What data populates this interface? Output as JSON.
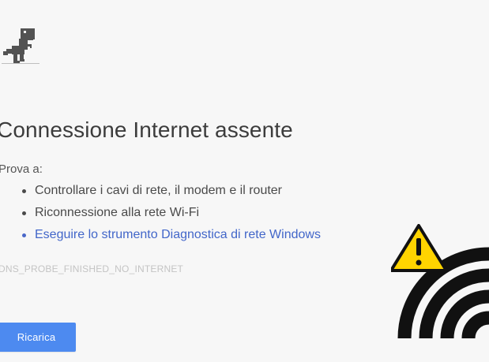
{
  "page": {
    "title": "Connessione Internet assente",
    "suggestions_intro": "Prova a:",
    "suggestions": [
      {
        "label": "Controllare i cavi di rete, il modem e il router"
      },
      {
        "label": "Riconnessione alla rete Wi-Fi"
      },
      {
        "label": "Eseguire lo strumento Diagnostica di rete Windows"
      }
    ],
    "error_code": "DNS_PROBE_FINISHED_NO_INTERNET",
    "reload_label": "Ricarica"
  },
  "icons": {
    "dino": "t-rex-icon",
    "warning": "warning-triangle-icon",
    "wifi": "wifi-icon"
  },
  "colors": {
    "background": "#f7f7f7",
    "title": "#3c3c3c",
    "body_text": "#4a4a4a",
    "link": "#4266c9",
    "error_code": "#c4c4c4",
    "button": "#4d8af0",
    "button_text": "#ffffff",
    "warning": "#ffd400",
    "wifi": "#111111"
  }
}
